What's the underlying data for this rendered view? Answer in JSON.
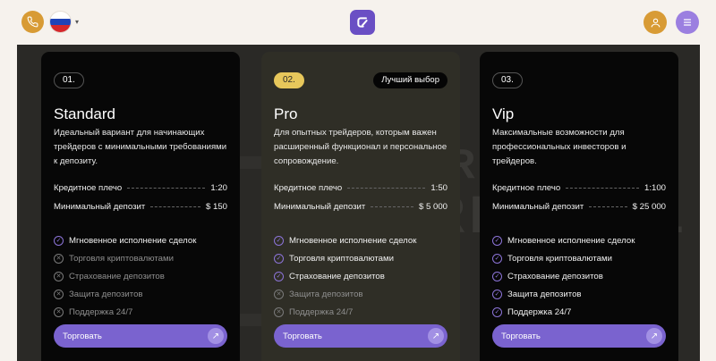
{
  "header": {
    "phone_icon": "phone-icon",
    "flag_icon": "russia-flag-icon",
    "flag_colors": [
      "#ffffff",
      "#1f43b8",
      "#d5272b"
    ],
    "logo_icon": "brand-logo-icon",
    "user_icon": "user-icon",
    "menu_icon": "menu-icon",
    "accent_color": "#d89b35",
    "brand_color": "#6a4fc4"
  },
  "watermark": {
    "line1": "BROKER",
    "line2": "TRIBUNAL"
  },
  "plans": [
    {
      "number": "01.",
      "badge": "",
      "title": "Standard",
      "description": "Идеальный вариант для начинающих трейдеров с минимальными требованиями к депозиту.",
      "leverage_label": "Кредитное плечо",
      "leverage_value": "1:20",
      "deposit_label": "Минимальный депозит",
      "deposit_value": "$ 150",
      "features": [
        {
          "label": "Мгновенное исполнение сделок",
          "enabled": true
        },
        {
          "label": "Торговля криптовалютами",
          "enabled": false
        },
        {
          "label": "Страхование депозитов",
          "enabled": false
        },
        {
          "label": "Защита депозитов",
          "enabled": false
        },
        {
          "label": "Поддержка 24/7",
          "enabled": false
        }
      ],
      "button_label": "Торговать"
    },
    {
      "number": "02.",
      "badge": "Лучший выбор",
      "title": "Pro",
      "description": "Для опытных трейдеров, которым важен расширенный функционал и персональное сопровождение.",
      "leverage_label": "Кредитное плечо",
      "leverage_value": "1:50",
      "deposit_label": "Минимальный депозит",
      "deposit_value": "$ 5 000",
      "features": [
        {
          "label": "Мгновенное исполнение сделок",
          "enabled": true
        },
        {
          "label": "Торговля криптовалютами",
          "enabled": true
        },
        {
          "label": "Страхование депозитов",
          "enabled": true
        },
        {
          "label": "Защита депозитов",
          "enabled": false
        },
        {
          "label": "Поддержка 24/7",
          "enabled": false
        }
      ],
      "button_label": "Торговать"
    },
    {
      "number": "03.",
      "badge": "",
      "title": "Vip",
      "description": "Максимальные возможности для профессиональных инвесторов и трейдеров.",
      "leverage_label": "Кредитное плечо",
      "leverage_value": "1:100",
      "deposit_label": "Минимальный депозит",
      "deposit_value": "$ 25 000",
      "features": [
        {
          "label": "Мгновенное исполнение сделок",
          "enabled": true
        },
        {
          "label": "Торговля криптовалютами",
          "enabled": true
        },
        {
          "label": "Страхование депозитов",
          "enabled": true
        },
        {
          "label": "Защита депозитов",
          "enabled": true
        },
        {
          "label": "Поддержка 24/7",
          "enabled": true
        }
      ],
      "button_label": "Торговать"
    }
  ]
}
